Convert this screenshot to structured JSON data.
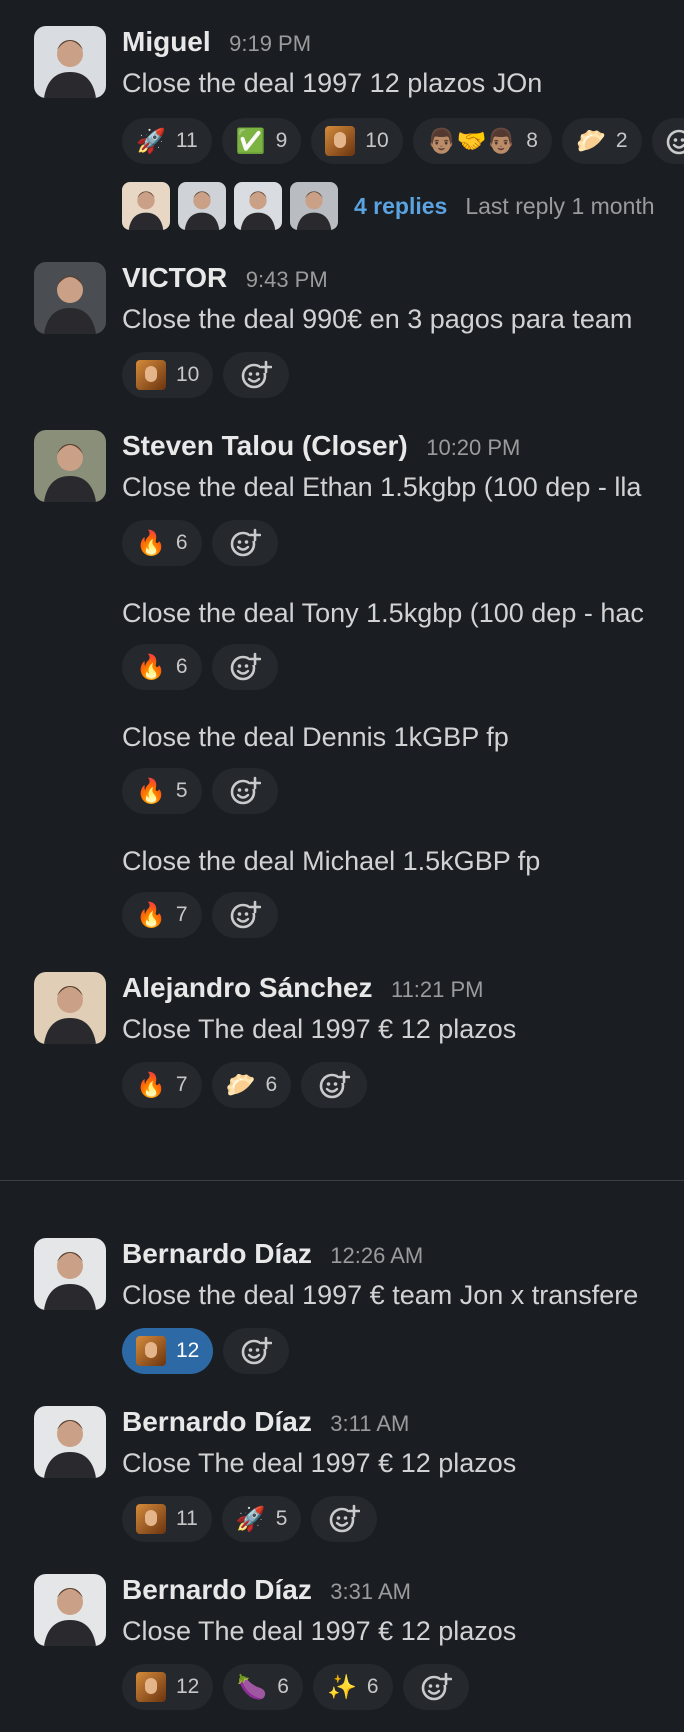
{
  "colors": {
    "background": "#1a1d21",
    "reaction_bg": "#25282c",
    "reaction_active": "#2d6aa5",
    "link": "#5aa2e0"
  },
  "messages": [
    {
      "name": "Miguel",
      "time": "9:19 PM",
      "text": "Close the deal 1997 12 plazos JOn",
      "reactions": [
        {
          "emoji": "🚀",
          "count": "11"
        },
        {
          "emoji": "✅",
          "count": "9"
        },
        {
          "emoji": "face",
          "count": "10"
        },
        {
          "emoji": "👨🏽‍🤝‍👨🏽",
          "count": "8"
        },
        {
          "emoji": "🥟",
          "count": "2"
        }
      ],
      "thread": {
        "replies": "4 replies",
        "last": "Last reply 1 month"
      }
    },
    {
      "name": "VICTOR",
      "time": "9:43 PM",
      "text": "Close the deal 990€ en 3 pagos para team",
      "reactions": [
        {
          "emoji": "face",
          "count": "10"
        }
      ]
    },
    {
      "name": "Steven Talou (Closer)",
      "time": "10:20 PM",
      "text": "Close the deal Ethan 1.5kgbp (100 dep - lla",
      "reactions": [
        {
          "emoji": "🔥",
          "count": "6"
        }
      ]
    },
    {
      "text": "Close the deal Tony 1.5kgbp (100 dep - hac",
      "reactions": [
        {
          "emoji": "🔥",
          "count": "6"
        }
      ]
    },
    {
      "text": "Close the deal Dennis 1kGBP fp",
      "reactions": [
        {
          "emoji": "🔥",
          "count": "5"
        }
      ]
    },
    {
      "text": "Close the deal Michael 1.5kGBP fp",
      "reactions": [
        {
          "emoji": "🔥",
          "count": "7"
        }
      ]
    },
    {
      "name": "Alejandro Sánchez",
      "time": "11:21 PM",
      "text": "Close The deal 1997 € 12 plazos",
      "reactions": [
        {
          "emoji": "🔥",
          "count": "7"
        },
        {
          "emoji": "🥟",
          "count": "6"
        }
      ]
    },
    {
      "name": "Bernardo Díaz",
      "time": "12:26 AM",
      "text": "Close the deal 1997 € team Jon x transfere",
      "reactions": [
        {
          "emoji": "face",
          "count": "12"
        }
      ]
    },
    {
      "name": "Bernardo Díaz",
      "time": "3:11 AM",
      "text": "Close The deal 1997 € 12 plazos",
      "reactions": [
        {
          "emoji": "face",
          "count": "11"
        },
        {
          "emoji": "🚀",
          "count": "5"
        }
      ]
    },
    {
      "name": "Bernardo Díaz",
      "time": "3:31 AM",
      "text": "Close The deal 1997 € 12 plazos",
      "reactions": [
        {
          "emoji": "face",
          "count": "12"
        },
        {
          "emoji": "🍆",
          "count": "6"
        },
        {
          "emoji": "✨",
          "count": "6"
        }
      ]
    }
  ],
  "icons": {
    "add_reaction": "add-reaction-icon",
    "avatar": "avatar-photo"
  }
}
